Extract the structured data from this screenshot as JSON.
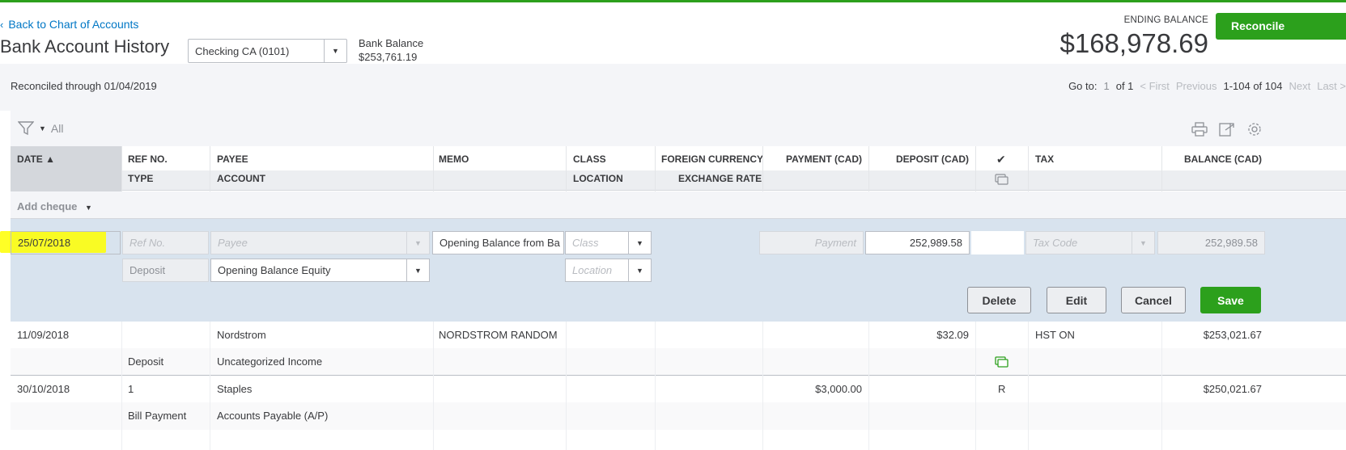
{
  "header": {
    "back_link": "Back to Chart of Accounts",
    "title": "Bank Account History",
    "account_select": "Checking CA (0101)",
    "bank_balance_label": "Bank Balance",
    "bank_balance_value": "$253,761.19",
    "ending_balance_label": "ENDING BALANCE",
    "ending_balance_value": "$168,978.69",
    "reconcile_label": "Reconcile"
  },
  "subbar": {
    "reconciled_through": "Reconciled through 01/04/2019",
    "goto_label": "Go to:",
    "page_num": "1",
    "of_pages": "of 1",
    "first": "< First",
    "previous": "Previous",
    "range": "1-104 of 104",
    "next": "Next",
    "last": "Last >"
  },
  "toolbar": {
    "filter_label": "All"
  },
  "columns": {
    "date": "DATE ▲",
    "ref_no": "REF NO.",
    "type": "TYPE",
    "payee": "PAYEE",
    "account": "ACCOUNT",
    "memo": "MEMO",
    "class": "CLASS",
    "location": "LOCATION",
    "foreign_currency": "FOREIGN CURRENCY",
    "exchange_rate": "EXCHANGE RATE",
    "payment": "PAYMENT (CAD)",
    "deposit": "DEPOSIT (CAD)",
    "check": "✔",
    "tax": "TAX",
    "balance": "BALANCE (CAD)"
  },
  "add_cheque": "Add cheque",
  "edit_row": {
    "date": "25/07/2018",
    "ref_placeholder": "Ref No.",
    "payee_placeholder": "Payee",
    "memo": "Opening Balance from Ba",
    "class_placeholder": "Class",
    "payment_placeholder": "Payment",
    "deposit": "252,989.58",
    "tax_placeholder": "Tax Code",
    "balance": "252,989.58",
    "type": "Deposit",
    "account": "Opening Balance Equity",
    "location_placeholder": "Location",
    "delete_label": "Delete",
    "edit_label": "Edit",
    "cancel_label": "Cancel",
    "save_label": "Save"
  },
  "rows": [
    {
      "date": "11/09/2018",
      "ref_no": "",
      "payee": "Nordstrom",
      "memo": "NORDSTROM RANDOM",
      "payment": "",
      "deposit": "$32.09",
      "status": "",
      "tax": "HST ON",
      "balance": "$253,021.67",
      "type": "Deposit",
      "account": "Uncategorized Income"
    },
    {
      "date": "30/10/2018",
      "ref_no": "1",
      "payee": "Staples",
      "memo": "",
      "payment": "$3,000.00",
      "deposit": "",
      "status": "R",
      "tax": "",
      "balance": "$250,021.67",
      "type": "Bill Payment",
      "account": "Accounts Payable (A/P)"
    }
  ]
}
